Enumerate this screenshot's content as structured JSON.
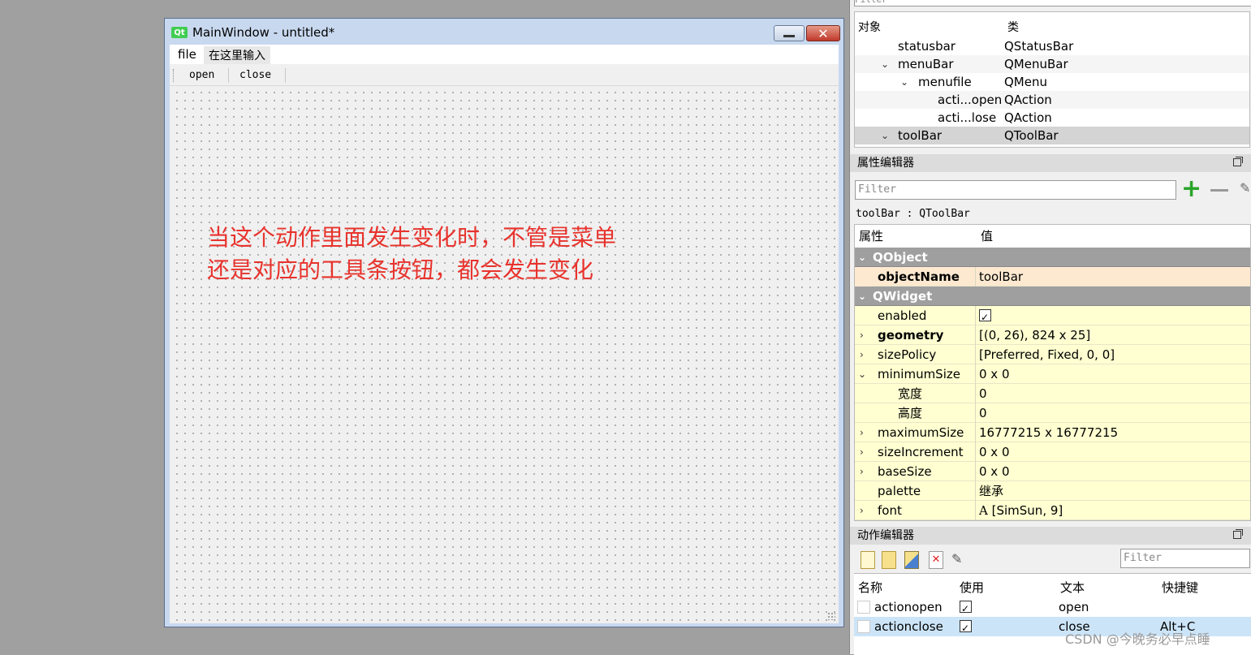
{
  "form_window": {
    "title": "MainWindow - untitled*",
    "icon": "Qt",
    "menu": [
      "file",
      "在这里输入"
    ],
    "toolbar_buttons": [
      "open",
      "close"
    ],
    "annotation_line1": "当这个动作里面发生变化时，不管是菜单",
    "annotation_line2": "还是对应的工具条按钮，都会发生变化"
  },
  "object_inspector": {
    "filter_placeholder": "Filter",
    "col_object": "对象",
    "col_class": "类",
    "rows": [
      {
        "name": "statusbar",
        "class": "QStatusBar"
      },
      {
        "name": "menuBar",
        "class": "QMenuBar"
      },
      {
        "name": "menufile",
        "class": "QMenu"
      },
      {
        "name": "acti...open",
        "class": "QAction"
      },
      {
        "name": "acti...lose",
        "class": "QAction"
      },
      {
        "name": "toolBar",
        "class": "QToolBar"
      }
    ]
  },
  "property_editor": {
    "title": "属性编辑器",
    "filter_placeholder": "Filter",
    "object_label": "toolBar : QToolBar",
    "col_property": "属性",
    "col_value": "值",
    "cat_qobject": "QObject",
    "cat_qwidget": "QWidget",
    "rows": [
      {
        "name": "objectName",
        "value": "toolBar"
      },
      {
        "name": "enabled",
        "value": ""
      },
      {
        "name": "geometry",
        "value": "[(0, 26), 824 x 25]"
      },
      {
        "name": "sizePolicy",
        "value": "[Preferred, Fixed, 0, 0]"
      },
      {
        "name": "minimumSize",
        "value": "0 x 0"
      },
      {
        "name": "宽度",
        "value": "0"
      },
      {
        "name": "高度",
        "value": "0"
      },
      {
        "name": "maximumSize",
        "value": "16777215 x 16777215"
      },
      {
        "name": "sizeIncrement",
        "value": "0 x 0"
      },
      {
        "name": "baseSize",
        "value": "0 x 0"
      },
      {
        "name": "palette",
        "value": "继承"
      },
      {
        "name": "font",
        "value": "[SimSun, 9]"
      }
    ],
    "font_glyph": "A"
  },
  "action_editor": {
    "title": "动作编辑器",
    "filter_placeholder": "Filter",
    "col_name": "名称",
    "col_used": "使用",
    "col_text": "文本",
    "col_shortcut": "快捷键",
    "rows": [
      {
        "name": "actionopen",
        "text": "open",
        "shortcut": ""
      },
      {
        "name": "actionclose",
        "text": "close",
        "shortcut": "Alt+C"
      }
    ]
  },
  "watermark": "CSDN @今晚务必早点睡",
  "colors": {
    "annotation": "#e8332d",
    "qt_green": "#41cd52",
    "category_bg": "#9f9f9f",
    "property_bg": "#ffffd1",
    "selected_row": "#cce4f7"
  }
}
